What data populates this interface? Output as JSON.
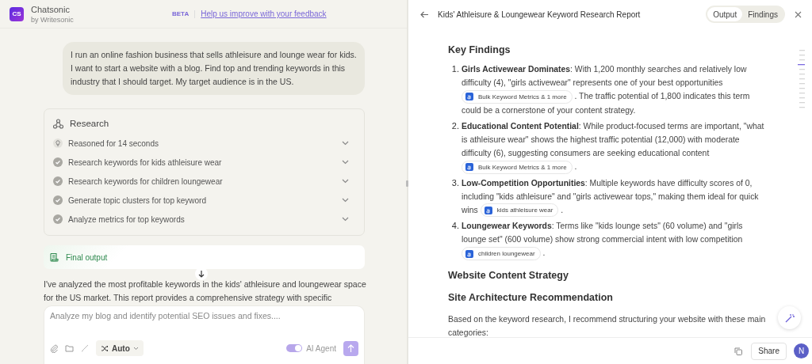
{
  "app": {
    "logo": "CS",
    "name": "Chatsonic",
    "byline": "by Writesonic"
  },
  "banner": {
    "badge": "BETA",
    "link": "Help us improve with your feedback"
  },
  "user_message": "I run an online fashion business that sells athleisure and lounge wear for kids. I want to start a website with a blog. Find top and trending keywords in this industry that I should target. My target audience is in the US.",
  "research": {
    "title": "Research",
    "steps": [
      {
        "kind": "reasoning",
        "label": "Reasoned for 14 seconds"
      },
      {
        "kind": "done",
        "label": "Research keywords for kids athleisure wear"
      },
      {
        "kind": "done",
        "label": "Research keywords for children loungewear"
      },
      {
        "kind": "done",
        "label": "Generate topic clusters for top keyword"
      },
      {
        "kind": "done",
        "label": "Analyze metrics for top keywords"
      }
    ]
  },
  "final_output": {
    "label": "Final output"
  },
  "answer_lines": [
    "I've analyzed the most profitable keywords in the kids' athleisure and loungewear space",
    "for the US market. This report provides a comprehensive strategy with specific"
  ],
  "composer": {
    "placeholder": "Analyze my blog and identify potential SEO issues and fixes....",
    "mode": "Auto",
    "agent_label": "AI Agent",
    "agent_on": true
  },
  "report": {
    "title": "Kids' Athleisure & Loungewear Keyword Research Report",
    "tabs": [
      {
        "label": "Output",
        "selected": true
      },
      {
        "label": "Findings",
        "selected": false
      }
    ],
    "sections": [
      {
        "kind": "heading",
        "text": "Key Findings"
      },
      {
        "kind": "list",
        "items": [
          {
            "number": "1.",
            "text": "**Girls Activewear Dominates**: With 1,200 monthly searches and relatively low difficulty (4), \"girls activewear\" represents one of your best opportunities",
            "source": "Bulk Keyword Metrics & 1 more",
            "tail": ". The traffic potential of 1,800 indicates this term could be a cornerstone of your content strategy."
          },
          {
            "number": "2.",
            "text": "**Educational Content Potential**: While product-focused terms are important, \"what is athleisure wear\" shows the highest traffic potential (12,000) with moderate difficulty (6), suggesting consumers are seeking educational content",
            "source": "Bulk Keyword Metrics & 1 more",
            "tail": "."
          },
          {
            "number": "3.",
            "text": "**Low-Competition Opportunities**: Multiple keywords have difficulty scores of 0, including \"kids athleisure\" and \"girls activewear tops,\" making them ideal for quick wins",
            "source": "kids athleisure wear",
            "tail": "."
          },
          {
            "number": "4.",
            "text": "**Loungewear Keywords**: Terms like \"kids lounge sets\" (60 volume) and \"girls lounge set\" (600 volume) show strong commercial intent with low competition",
            "source": "children loungewear",
            "tail": "."
          }
        ]
      },
      {
        "kind": "heading",
        "text": "Website Content Strategy"
      },
      {
        "kind": "heading",
        "text": "Site Architecture Recommendation"
      },
      {
        "kind": "paragraph",
        "text": "Based on the keyword research, I recommend structuring your website with these main categories:"
      }
    ]
  },
  "footer": {
    "share": "Share",
    "avatar": "N"
  }
}
